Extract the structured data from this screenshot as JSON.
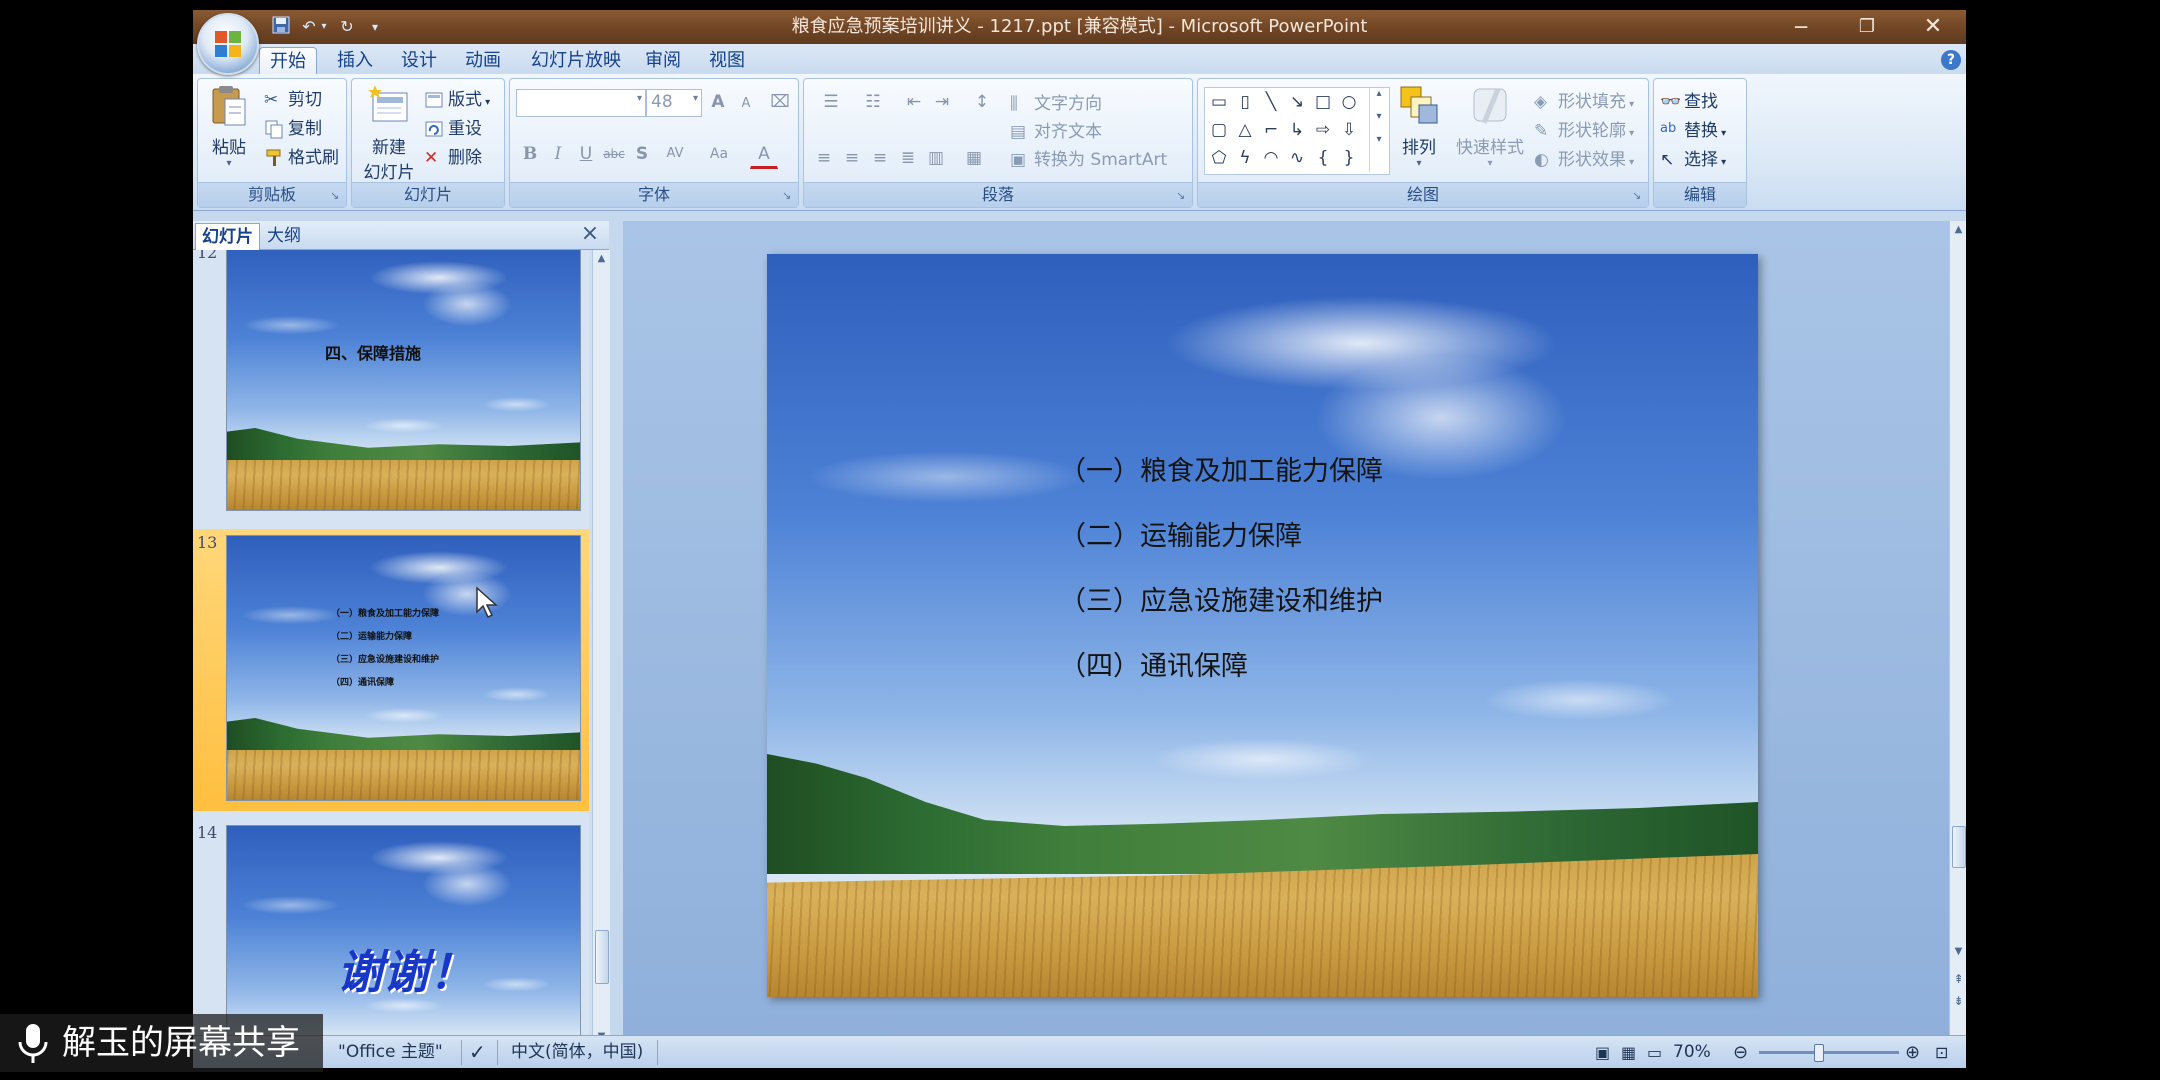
{
  "window": {
    "title": "粮食应急预案培训讲义 - 1217.ppt [兼容模式] - Microsoft PowerPoint"
  },
  "tabs": [
    "开始",
    "插入",
    "设计",
    "动画",
    "幻灯片放映",
    "审阅",
    "视图"
  ],
  "ribbon": {
    "clipboard": {
      "name": "剪贴板",
      "paste": "粘贴",
      "cut": "剪切",
      "copy": "复制",
      "format_painter": "格式刷"
    },
    "slides": {
      "name": "幻灯片",
      "new_slide_1": "新建",
      "new_slide_2": "幻灯片",
      "layout": "版式",
      "reset": "重设",
      "delete": "删除"
    },
    "font": {
      "name": "字体",
      "font_size": "48",
      "bold": "B",
      "italic": "I",
      "underline": "U",
      "strike": "abc",
      "shadow": "S",
      "spacing": "AV",
      "case": "Aa",
      "color": "A",
      "grow": "A",
      "shrink": "A"
    },
    "paragraph": {
      "name": "段落",
      "text_direction": "文字方向",
      "align_text": "对齐文本",
      "smartart": "转换为 SmartArt"
    },
    "drawing": {
      "name": "绘图",
      "arrange": "排列",
      "quick_styles": "快速样式",
      "shape_fill": "形状填充",
      "shape_outline": "形状轮廓",
      "shape_effects": "形状效果"
    },
    "editing": {
      "name": "编辑",
      "find": "查找",
      "replace": "替换",
      "select": "选择"
    }
  },
  "pane": {
    "tab_slides": "幻灯片",
    "tab_outline": "大纲",
    "thumbnails": [
      {
        "number": "12",
        "title": "四、保障措施"
      },
      {
        "number": "13",
        "lines": [
          "（一）粮食及加工能力保障",
          "（二）运输能力保障",
          "（三）应急设施建设和维护",
          "（四）通讯保障"
        ]
      },
      {
        "number": "14",
        "title": "谢谢！"
      }
    ]
  },
  "slide": {
    "lines": [
      "（一）粮食及加工能力保障",
      "（二）运输能力保障",
      "（三）应急设施建设和维护",
      "（四）通讯保障"
    ]
  },
  "status": {
    "theme": "\"Office 主题\"",
    "language": "中文(简体，中国)",
    "zoom": "70%",
    "zoom_fraction": 0.42
  },
  "overlay": {
    "text": "解玉的屏幕共享"
  },
  "colors": {
    "titlebar": "#6e4424",
    "ribbon": "#d9e7f6",
    "selection": "#ffbf3f"
  }
}
